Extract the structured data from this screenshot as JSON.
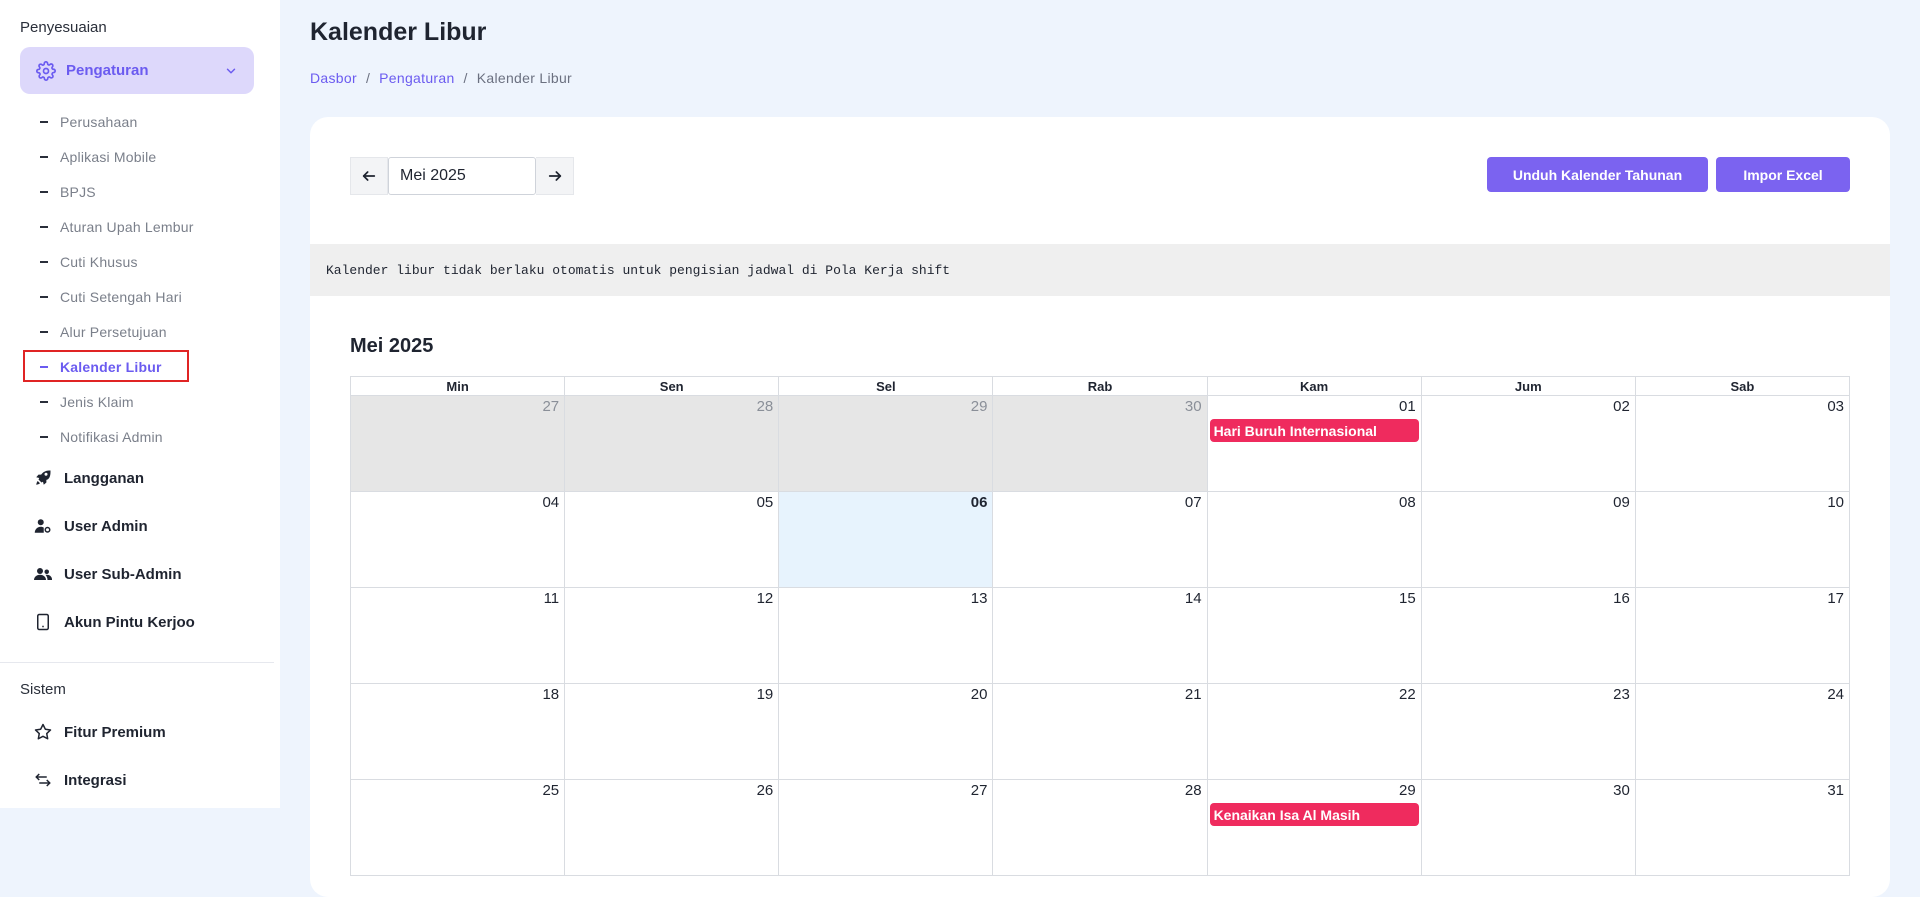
{
  "sidebar": {
    "section_customize": "Penyesuaian",
    "active_menu": "Pengaturan",
    "sub_items": [
      {
        "label": "Perusahaan"
      },
      {
        "label": "Aplikasi Mobile"
      },
      {
        "label": "BPJS"
      },
      {
        "label": "Aturan Upah Lembur"
      },
      {
        "label": "Cuti Khusus"
      },
      {
        "label": "Cuti Setengah Hari"
      },
      {
        "label": "Alur Persetujuan"
      },
      {
        "label": "Kalender Libur"
      },
      {
        "label": "Jenis Klaim"
      },
      {
        "label": "Notifikasi Admin"
      }
    ],
    "main_items": [
      {
        "label": "Langganan",
        "icon": "rocket-icon"
      },
      {
        "label": "User Admin",
        "icon": "user-gear-icon"
      },
      {
        "label": "User Sub-Admin",
        "icon": "users-icon"
      },
      {
        "label": "Akun Pintu Kerjoo",
        "icon": "tablet-icon"
      }
    ],
    "section_system": "Sistem",
    "system_items": [
      {
        "label": "Fitur Premium",
        "icon": "star-icon"
      },
      {
        "label": "Integrasi",
        "icon": "arrows-icon"
      }
    ]
  },
  "header": {
    "title": "Kalender Libur",
    "breadcrumb": [
      "Dasbor",
      "Pengaturan",
      "Kalender Libur"
    ]
  },
  "toolbar": {
    "month_value": "Mei 2025",
    "download_label": "Unduh Kalender Tahunan",
    "import_label": "Impor Excel"
  },
  "notice": "Kalender libur tidak berlaku otomatis untuk pengisian jadwal di Pola Kerja shift",
  "calendar": {
    "title": "Mei 2025",
    "weekdays": [
      "Min",
      "Sen",
      "Sel",
      "Rab",
      "Kam",
      "Jum",
      "Sab"
    ],
    "weeks": [
      [
        {
          "d": "27",
          "o": true
        },
        {
          "d": "28",
          "o": true
        },
        {
          "d": "29",
          "o": true
        },
        {
          "d": "30",
          "o": true
        },
        {
          "d": "01",
          "e": "Hari Buruh Internasional"
        },
        {
          "d": "02"
        },
        {
          "d": "03"
        }
      ],
      [
        {
          "d": "04"
        },
        {
          "d": "05"
        },
        {
          "d": "06",
          "t": true
        },
        {
          "d": "07"
        },
        {
          "d": "08"
        },
        {
          "d": "09"
        },
        {
          "d": "10"
        }
      ],
      [
        {
          "d": "11"
        },
        {
          "d": "12"
        },
        {
          "d": "13"
        },
        {
          "d": "14"
        },
        {
          "d": "15"
        },
        {
          "d": "16"
        },
        {
          "d": "17"
        }
      ],
      [
        {
          "d": "18"
        },
        {
          "d": "19"
        },
        {
          "d": "20"
        },
        {
          "d": "21"
        },
        {
          "d": "22"
        },
        {
          "d": "23"
        },
        {
          "d": "24"
        }
      ],
      [
        {
          "d": "25"
        },
        {
          "d": "26"
        },
        {
          "d": "27"
        },
        {
          "d": "28"
        },
        {
          "d": "29",
          "e": "Kenaikan Isa Al Masih"
        },
        {
          "d": "30"
        },
        {
          "d": "31"
        }
      ]
    ]
  },
  "colors": {
    "accent": "#7b63f0",
    "event": "#ef2b5e",
    "today": "#e7f3fd"
  }
}
